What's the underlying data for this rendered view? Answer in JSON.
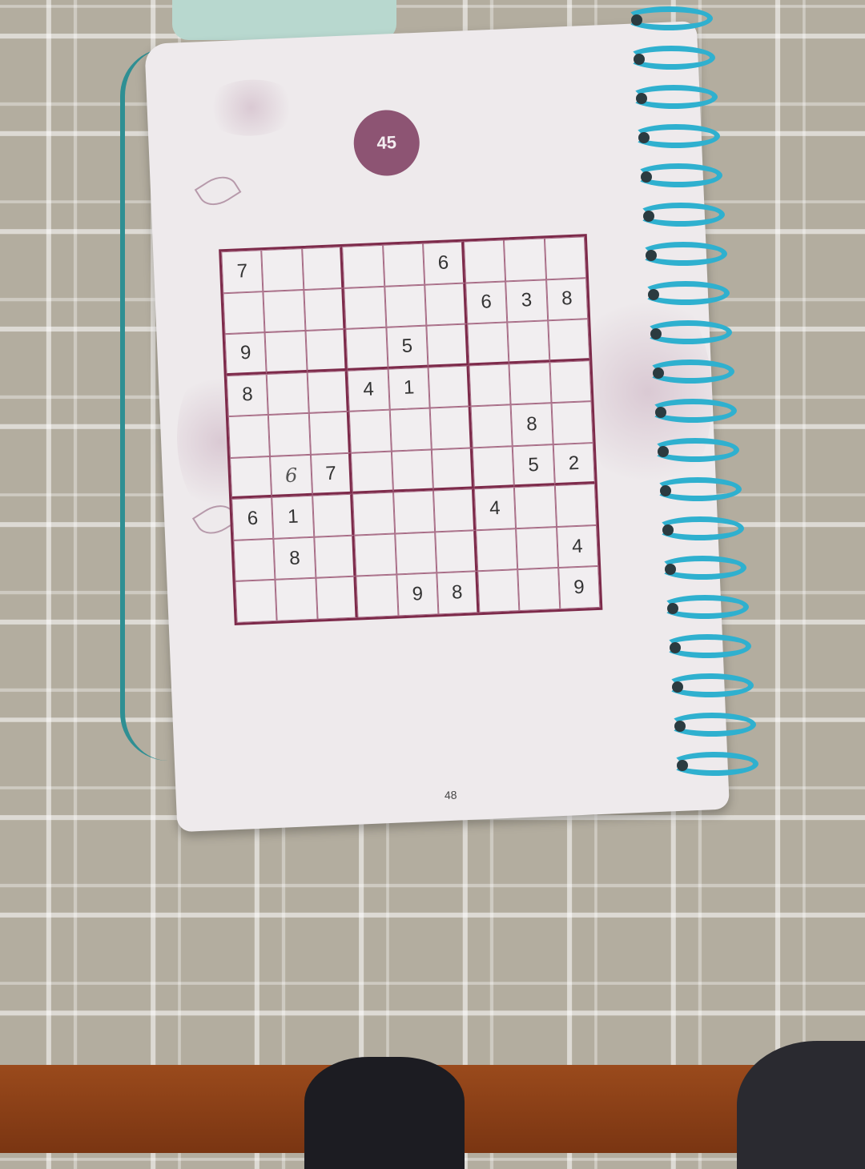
{
  "puzzle": {
    "number": "45",
    "page_number": "48",
    "grid": [
      [
        "7",
        "",
        "",
        "",
        "",
        "6",
        "",
        "",
        ""
      ],
      [
        "",
        "",
        "",
        "",
        "",
        "",
        "6",
        "3",
        "8"
      ],
      [
        "9",
        "",
        "",
        "",
        "5",
        "",
        "",
        "",
        ""
      ],
      [
        "8",
        "",
        "",
        "4",
        "1",
        "",
        "",
        "",
        ""
      ],
      [
        "",
        "",
        "",
        "",
        "",
        "",
        "",
        "8",
        ""
      ],
      [
        "",
        "6",
        "7",
        "",
        "",
        "",
        "",
        "5",
        "2"
      ],
      [
        "6",
        "1",
        "",
        "",
        "",
        "",
        "4",
        "",
        ""
      ],
      [
        "",
        "8",
        "",
        "",
        "",
        "",
        "",
        "",
        "4"
      ],
      [
        "",
        "",
        "",
        "",
        "9",
        "8",
        "",
        "",
        "9"
      ]
    ],
    "hand_cells": [
      [
        5,
        1
      ]
    ]
  }
}
